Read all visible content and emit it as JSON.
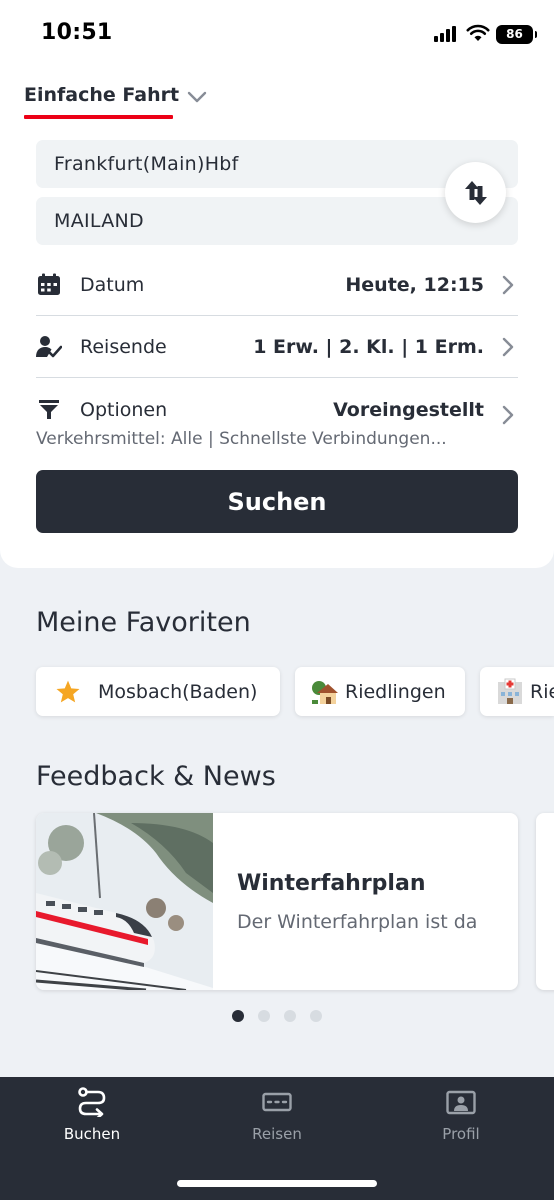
{
  "status_bar": {
    "time": "10:51",
    "battery": "86"
  },
  "trip_type": {
    "label": "Einfache Fahrt"
  },
  "stations": {
    "from": "Frankfurt(Main)Hbf",
    "to": "MAILAND"
  },
  "rows": {
    "date": {
      "label": "Datum",
      "value": "Heute, 12:15"
    },
    "travellers": {
      "label": "Reisende",
      "value": "1 Erw. | 2. Kl. | 1 Erm."
    },
    "options": {
      "label": "Optionen",
      "value": "Voreingestellt",
      "subtext": "Verkehrsmittel: Alle | Schnellste Verbindungen..."
    }
  },
  "search_button": "Suchen",
  "favorites": {
    "title": "Meine Favoriten",
    "items": [
      {
        "label": "Mosbach(Baden)",
        "icon": "star-icon"
      },
      {
        "label": "Riedlingen",
        "icon": "house-icon"
      },
      {
        "label": "Rie",
        "icon": "hospital-icon"
      }
    ]
  },
  "news": {
    "title": "Feedback & News",
    "card": {
      "title": "Winterfahrplan",
      "text": "Der Winterfahrplan ist da"
    },
    "page_count": 4,
    "active_page": 0
  },
  "tabs": [
    {
      "label": "Buchen",
      "icon": "route-icon",
      "active": true
    },
    {
      "label": "Reisen",
      "icon": "ticket-icon",
      "active": false
    },
    {
      "label": "Profil",
      "icon": "profile-icon",
      "active": false
    }
  ],
  "colors": {
    "accent": "#ec0016",
    "dark": "#282d37",
    "background": "#eef1f5"
  }
}
